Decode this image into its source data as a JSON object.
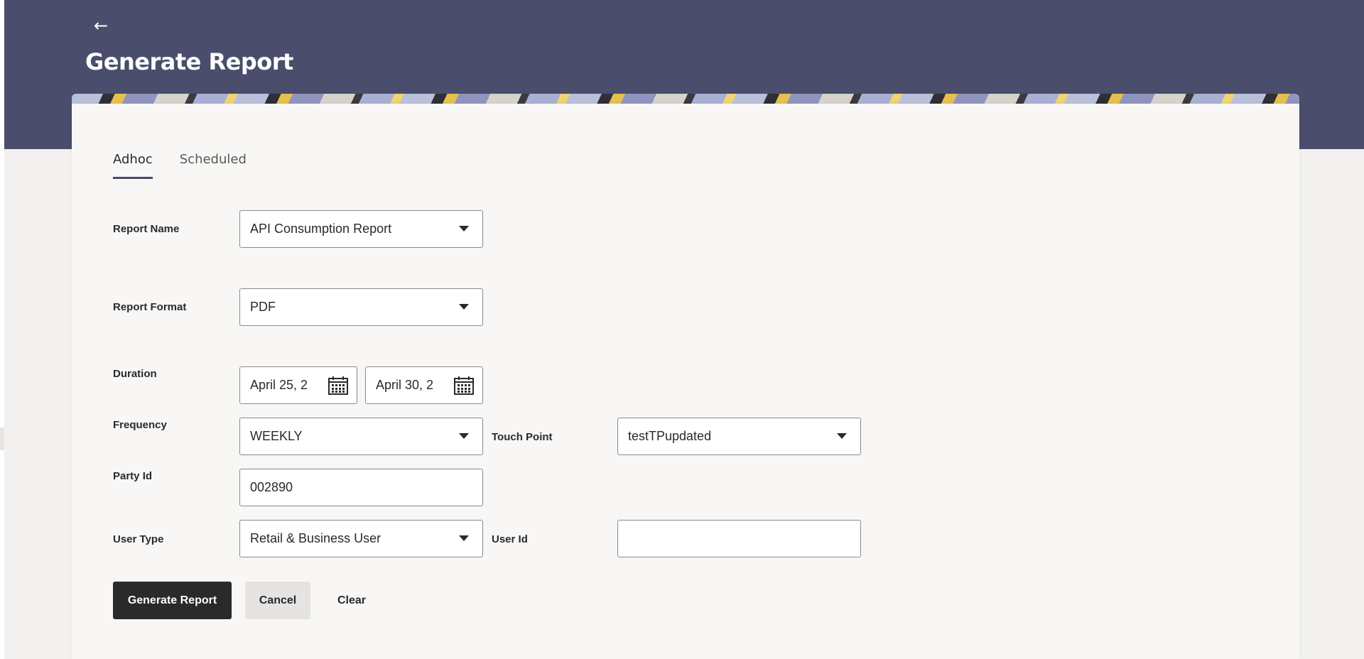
{
  "header": {
    "back_icon": "back-arrow-icon",
    "back_glyph": "←",
    "title": "Generate Report"
  },
  "tabs": [
    {
      "label": "Adhoc",
      "active": true
    },
    {
      "label": "Scheduled",
      "active": false
    }
  ],
  "form": {
    "report_name": {
      "label": "Report Name",
      "value": "API Consumption Report"
    },
    "report_format": {
      "label": "Report Format",
      "value": "PDF"
    },
    "duration": {
      "label": "Duration",
      "from": "April 25, 2",
      "to": "April 30, 2"
    },
    "frequency": {
      "label": "Frequency",
      "value": "WEEKLY"
    },
    "touch_point": {
      "label": "Touch Point",
      "value": "testTPupdated"
    },
    "party_id": {
      "label": "Party Id",
      "value": "002890"
    },
    "user_type": {
      "label": "User Type",
      "value": "Retail & Business User"
    },
    "user_id": {
      "label": "User Id",
      "value": ""
    }
  },
  "actions": {
    "generate": "Generate Report",
    "cancel": "Cancel",
    "clear": "Clear"
  },
  "colors": {
    "header_bg": "#4a4d6b",
    "primary_button": "#2b2a2a",
    "secondary_button": "#e6e4e2"
  }
}
